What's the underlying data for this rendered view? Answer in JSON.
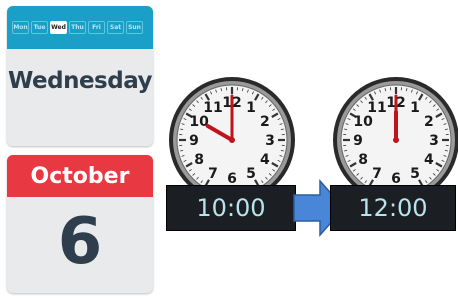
{
  "calendar": {
    "weekdays": [
      "Mon",
      "Tue",
      "Wed",
      "Thu",
      "Fri",
      "Sat",
      "Sun"
    ],
    "active_day": "Wed",
    "day_name": "Wednesday",
    "month": "October",
    "date": "6"
  },
  "clocks": [
    {
      "time": "10:00",
      "hour": 10,
      "minute": 0
    },
    {
      "time": "12:00",
      "hour": 12,
      "minute": 0
    }
  ],
  "clock_numbers": [
    "12",
    "1",
    "2",
    "3",
    "4",
    "5",
    "6",
    "7",
    "8",
    "9",
    "10",
    "11"
  ],
  "colors": {
    "week_bar": "#1aa0c8",
    "month_bar": "#e83841",
    "arrow": "#4a86d8",
    "hand": "#c0141c"
  },
  "icons": {
    "arrow": "right-arrow-icon"
  }
}
